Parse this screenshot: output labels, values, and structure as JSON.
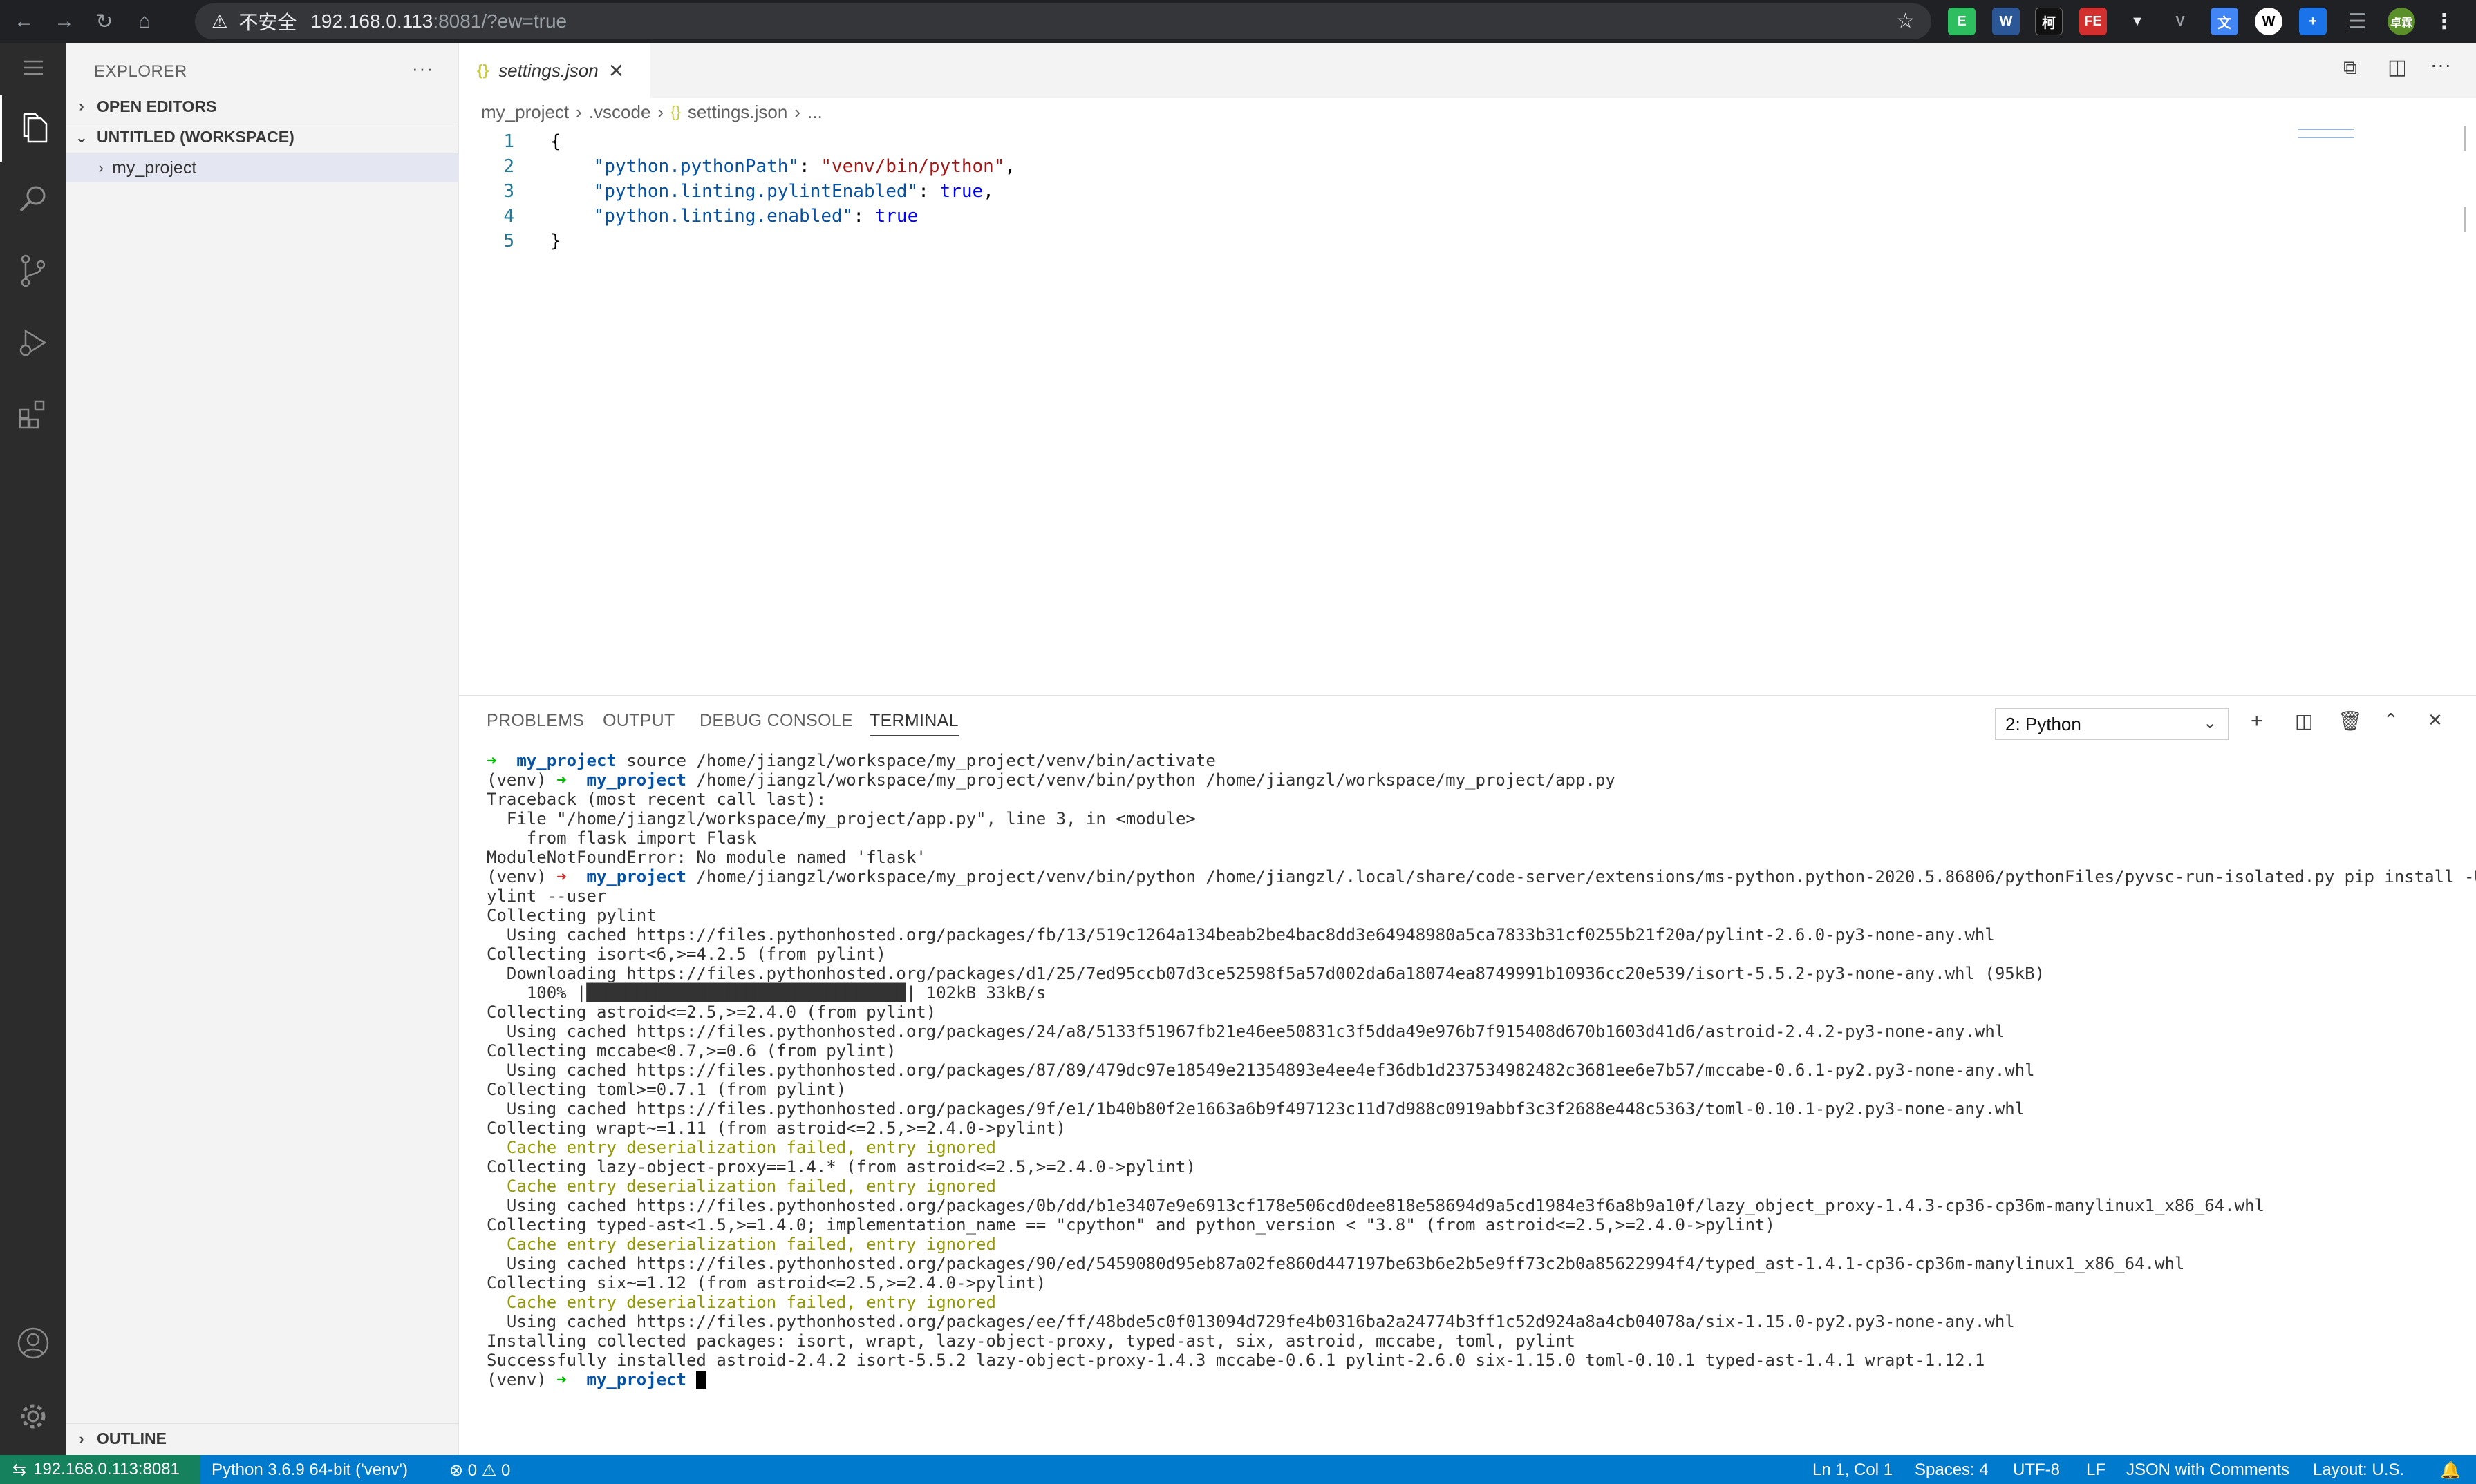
{
  "browser": {
    "security_label": "不安全",
    "url_host": "192.168.0.113",
    "url_rest": ":8081/?ew=true",
    "profile_badge": "卓霖"
  },
  "sidebar": {
    "title": "EXPLORER",
    "more_label": "···",
    "open_editors": "OPEN EDITORS",
    "workspace": "UNTITLED (WORKSPACE)",
    "folder": "my_project",
    "outline": "OUTLINE"
  },
  "editor": {
    "tab_icon": "{}",
    "tab_label": "settings.json",
    "breadcrumb": [
      "my_project",
      ".vscode",
      "settings.json",
      "..."
    ],
    "lines": [
      {
        "n": "1",
        "indent": "",
        "key": "",
        "sep": "",
        "val": "",
        "plain": "{",
        "cls": ""
      },
      {
        "n": "2",
        "indent": "    ",
        "key": "\"python.pythonPath\"",
        "sep": ": ",
        "val": "\"venv/bin/python\"",
        "plain": ",",
        "cls": "s"
      },
      {
        "n": "3",
        "indent": "    ",
        "key": "\"python.linting.pylintEnabled\"",
        "sep": ": ",
        "val": "true",
        "plain": ",",
        "cls": "b"
      },
      {
        "n": "4",
        "indent": "    ",
        "key": "\"python.linting.enabled\"",
        "sep": ": ",
        "val": "true",
        "plain": "",
        "cls": "b"
      },
      {
        "n": "5",
        "indent": "",
        "key": "",
        "sep": "",
        "val": "",
        "plain": "}",
        "cls": ""
      }
    ]
  },
  "panel": {
    "tabs": [
      "PROBLEMS",
      "OUTPUT",
      "DEBUG CONSOLE",
      "TERMINAL"
    ],
    "terminal_select": "2: Python",
    "terminal_lines": [
      [
        {
          "t": "➜  ",
          "c": "g"
        },
        {
          "t": "my_project",
          "c": "p"
        },
        {
          "t": " source /home/jiangzl/workspace/my_project/venv/bin/activate"
        }
      ],
      [
        {
          "t": "(venv) "
        },
        {
          "t": "➜  ",
          "c": "g"
        },
        {
          "t": "my_project",
          "c": "p"
        },
        {
          "t": " /home/jiangzl/workspace/my_project/venv/bin/python /home/jiangzl/workspace/my_project/app.py"
        }
      ],
      [
        {
          "t": "Traceback (most recent call last):"
        }
      ],
      [
        {
          "t": "  File \"/home/jiangzl/workspace/my_project/app.py\", line 3, in <module>"
        }
      ],
      [
        {
          "t": "    from flask import Flask"
        }
      ],
      [
        {
          "t": "ModuleNotFoundError: No module named 'flask'"
        }
      ],
      [
        {
          "t": "(venv) "
        },
        {
          "t": "➜  ",
          "c": "r"
        },
        {
          "t": "my_project",
          "c": "p"
        },
        {
          "t": " /home/jiangzl/workspace/my_project/venv/bin/python /home/jiangzl/.local/share/code-server/extensions/ms-python.python-2020.5.86806/pythonFiles/pyvsc-run-isolated.py pip install -U p"
        }
      ],
      [
        {
          "t": "ylint --user"
        }
      ],
      [
        {
          "t": "Collecting pylint"
        }
      ],
      [
        {
          "t": "  Using cached https://files.pythonhosted.org/packages/fb/13/519c1264a134beab2be4bac8dd3e64948980a5ca7833b31cf0255b21f20a/pylint-2.6.0-py3-none-any.whl"
        }
      ],
      [
        {
          "t": "Collecting isort<6,>=4.2.5 (from pylint)"
        }
      ],
      [
        {
          "t": "  Downloading https://files.pythonhosted.org/packages/d1/25/7ed95ccb07d3ce52598f5a57d002da6a18074ea8749991b10936cc20e539/isort-5.5.2-py3-none-any.whl (95kB)"
        }
      ],
      [
        {
          "t": "    100% |"
        },
        {
          "t": "████████████████████████████████",
          "c": "bar"
        },
        {
          "t": "| 102kB 33kB/s"
        }
      ],
      [
        {
          "t": "Collecting astroid<=2.5,>=2.4.0 (from pylint)"
        }
      ],
      [
        {
          "t": "  Using cached https://files.pythonhosted.org/packages/24/a8/5133f51967fb21e46ee50831c3f5dda49e976b7f915408d670b1603d41d6/astroid-2.4.2-py3-none-any.whl"
        }
      ],
      [
        {
          "t": "Collecting mccabe<0.7,>=0.6 (from pylint)"
        }
      ],
      [
        {
          "t": "  Using cached https://files.pythonhosted.org/packages/87/89/479dc97e18549e21354893e4ee4ef36db1d237534982482c3681ee6e7b57/mccabe-0.6.1-py2.py3-none-any.whl"
        }
      ],
      [
        {
          "t": "Collecting toml>=0.7.1 (from pylint)"
        }
      ],
      [
        {
          "t": "  Using cached https://files.pythonhosted.org/packages/9f/e1/1b40b80f2e1663a6b9f497123c11d7d988c0919abbf3c3f2688e448c5363/toml-0.10.1-py2.py3-none-any.whl"
        }
      ],
      [
        {
          "t": "Collecting wrapt~=1.11 (from astroid<=2.5,>=2.4.0->pylint)"
        }
      ],
      [
        {
          "t": "  Cache entry deserialization failed, entry ignored",
          "c": "y"
        }
      ],
      [
        {
          "t": "Collecting lazy-object-proxy==1.4.* (from astroid<=2.5,>=2.4.0->pylint)"
        }
      ],
      [
        {
          "t": "  Cache entry deserialization failed, entry ignored",
          "c": "y"
        }
      ],
      [
        {
          "t": "  Using cached https://files.pythonhosted.org/packages/0b/dd/b1e3407e9e6913cf178e506cd0dee818e58694d9a5cd1984e3f6a8b9a10f/lazy_object_proxy-1.4.3-cp36-cp36m-manylinux1_x86_64.whl"
        }
      ],
      [
        {
          "t": "Collecting typed-ast<1.5,>=1.4.0; implementation_name == \"cpython\" and python_version < \"3.8\" (from astroid<=2.5,>=2.4.0->pylint)"
        }
      ],
      [
        {
          "t": "  Cache entry deserialization failed, entry ignored",
          "c": "y"
        }
      ],
      [
        {
          "t": "  Using cached https://files.pythonhosted.org/packages/90/ed/5459080d95eb87a02fe860d447197be63b6e2b5e9ff73c2b0a85622994f4/typed_ast-1.4.1-cp36-cp36m-manylinux1_x86_64.whl"
        }
      ],
      [
        {
          "t": "Collecting six~=1.12 (from astroid<=2.5,>=2.4.0->pylint)"
        }
      ],
      [
        {
          "t": "  Cache entry deserialization failed, entry ignored",
          "c": "y"
        }
      ],
      [
        {
          "t": "  Using cached https://files.pythonhosted.org/packages/ee/ff/48bde5c0f013094d729fe4b0316ba2a24774b3ff1c52d924a8a4cb04078a/six-1.15.0-py2.py3-none-any.whl"
        }
      ],
      [
        {
          "t": "Installing collected packages: isort, wrapt, lazy-object-proxy, typed-ast, six, astroid, mccabe, toml, pylint"
        }
      ],
      [
        {
          "t": "Successfully installed astroid-2.4.2 isort-5.5.2 lazy-object-proxy-1.4.3 mccabe-0.6.1 pylint-2.6.0 six-1.15.0 toml-0.10.1 typed-ast-1.4.1 wrapt-1.12.1"
        }
      ],
      [
        {
          "t": "(venv) "
        },
        {
          "t": "➜  ",
          "c": "g"
        },
        {
          "t": "my_project",
          "c": "p"
        },
        {
          "t": " "
        },
        {
          "t": " ",
          "c": "cursor"
        }
      ]
    ]
  },
  "status": {
    "remote": "192.168.0.113:8081",
    "interpreter": "Python 3.6.9 64-bit ('venv')",
    "errors": "0",
    "warnings": "0",
    "position": "Ln 1, Col 1",
    "spaces": "Spaces: 4",
    "encoding": "UTF-8",
    "eol": "LF",
    "language": "JSON with Comments",
    "layout": "Layout: U.S."
  },
  "colors": {
    "status_bar": "#007acc",
    "remote_indicator": "#16825d",
    "activity_bar": "#2c2c2c",
    "chrome_bar": "#202124"
  }
}
